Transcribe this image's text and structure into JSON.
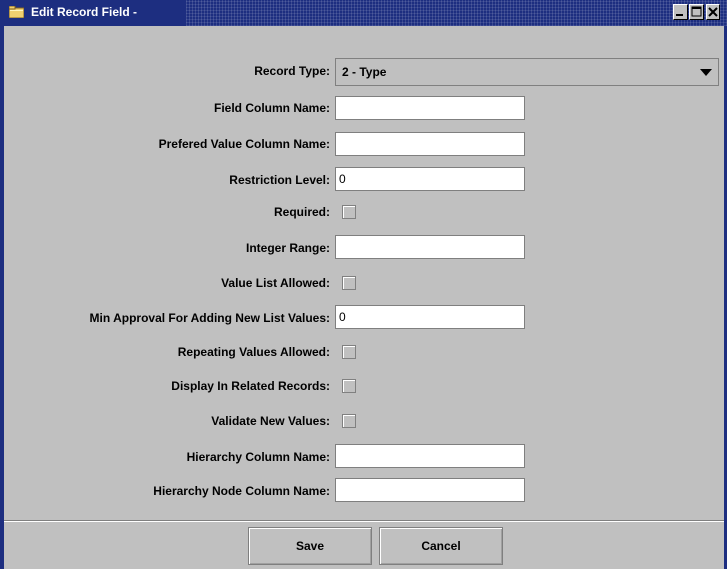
{
  "window": {
    "title": "Edit Record Field -",
    "controls": [
      "minimize",
      "maximize",
      "close"
    ]
  },
  "form": {
    "record_type": {
      "label": "Record Type:",
      "value": "2 - Type"
    },
    "field_column_name": {
      "label": "Field Column Name:",
      "value": ""
    },
    "preferred_value_column_name": {
      "label": "Prefered Value Column Name:",
      "value": ""
    },
    "restriction_level": {
      "label": "Restriction Level:",
      "value": "0"
    },
    "required": {
      "label": "Required:",
      "checked": false
    },
    "integer_range": {
      "label": "Integer Range:",
      "value": ""
    },
    "value_list_allowed": {
      "label": "Value List Allowed:",
      "checked": false
    },
    "min_approval": {
      "label": "Min Approval For Adding New List Values:",
      "value": "0"
    },
    "repeating_values_allowed": {
      "label": "Repeating Values Allowed:",
      "checked": false
    },
    "display_in_related_records": {
      "label": "Display In Related Records:",
      "checked": false
    },
    "validate_new_values": {
      "label": "Validate New Values:",
      "checked": false
    },
    "hierarchy_column_name": {
      "label": "Hierarchy Column Name:",
      "value": ""
    },
    "hierarchy_node_column_name": {
      "label": "Hierarchy Node Column Name:",
      "value": ""
    }
  },
  "buttons": {
    "save": "Save",
    "cancel": "Cancel"
  },
  "colors": {
    "titlebar": "#1d2e80",
    "panel": "#c0c0c0",
    "field": "#ffffff"
  },
  "icons": {
    "title": "folder-icon",
    "select": "chevron-down-icon"
  }
}
